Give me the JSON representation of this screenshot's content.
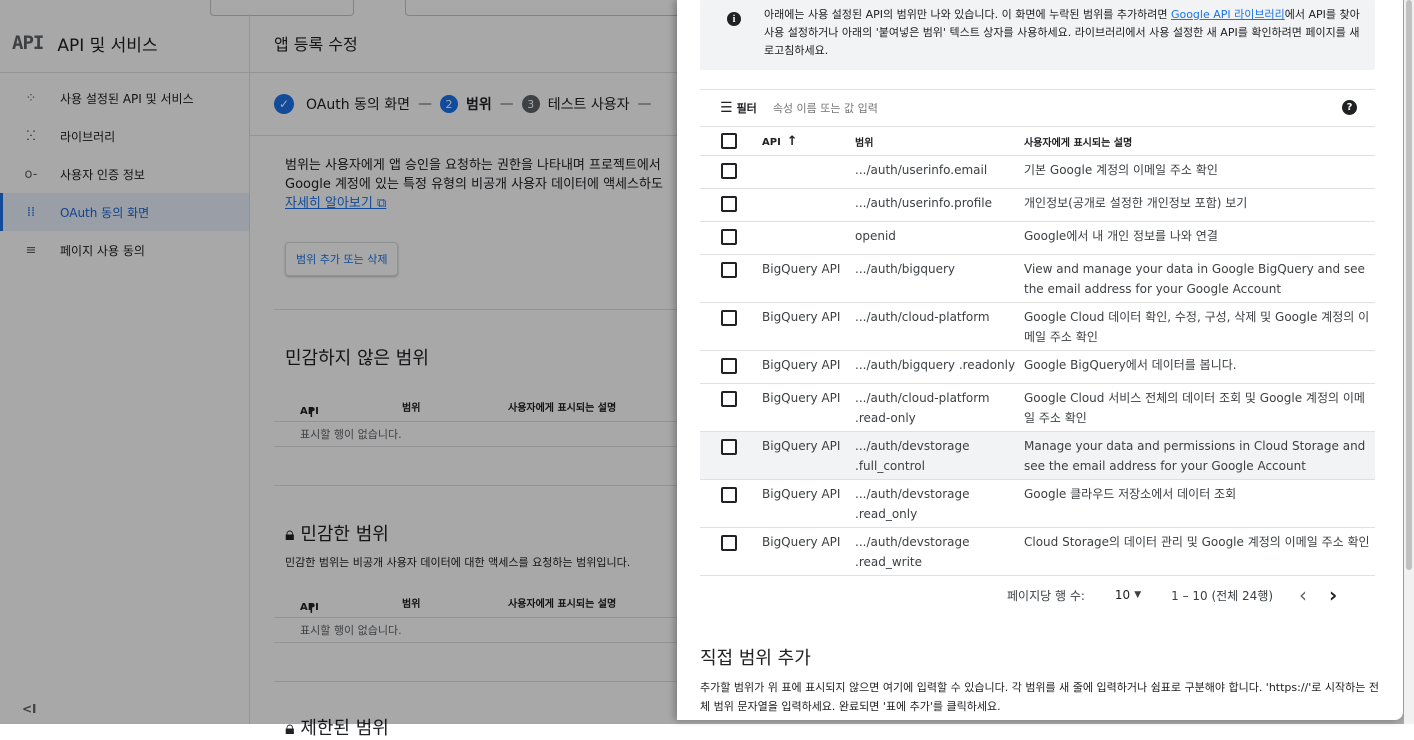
{
  "left_nav": {
    "logo": "API",
    "title": "API 및 서비스",
    "items": [
      {
        "label": "사용 설정된 API 및 서비스",
        "icon": "diamond-arrows-icon",
        "glyph": "⁘"
      },
      {
        "label": "라이브러리",
        "icon": "library-grid-icon",
        "glyph": "ⵘ"
      },
      {
        "label": "사용자 인증 정보",
        "icon": "key-icon",
        "glyph": "o-"
      },
      {
        "label": "OAuth 동의 화면",
        "icon": "oauth-dots-icon",
        "glyph": "⁞⁞"
      },
      {
        "label": "페이지 사용 동의",
        "icon": "list-settings-icon",
        "glyph": "≡"
      }
    ],
    "active_index": 3,
    "collapse_label": "<I"
  },
  "main": {
    "header": "앱 등록 수정",
    "steps": [
      {
        "marker": "✓",
        "label": "OAuth 동의 화면"
      },
      {
        "marker": "2",
        "label": "범위"
      },
      {
        "marker": "3",
        "label": "테스트 사용자"
      }
    ],
    "step_separator": "—",
    "description_line1": "범위는 사용자에게 앱 승인을 요청하는 권한을 나타내며 프로젝트에서",
    "description_line2": "Google 계정에 있는 특정 유형의 비공개 사용자 데이터에 액세스하도",
    "learn_more": "자세히 알아보기 ⧉",
    "add_remove_button": "범위 추가 또는 삭제",
    "nonsensitive": {
      "title": "민감하지 않은 범위",
      "col_api": "API",
      "col_scope": "범위",
      "col_desc": "사용자에게 표시되는 설명",
      "empty": "표시할 행이 없습니다."
    },
    "sensitive": {
      "title": "민감한 범위",
      "subtitle": "민감한 범위는 비공개 사용자 데이터에 대한 액세스를 요청하는 범위입니다.",
      "col_api": "API",
      "col_scope": "범위",
      "col_desc": "사용자에게 표시되는 설명",
      "empty": "표시할 행이 없습니다."
    },
    "restricted_title_partial": "제한된 범위"
  },
  "panel": {
    "info_text_before_link": "아래에는 사용 설정된 API의 범위만 나와 있습니다. 이 화면에 누락된 범위를 추가하려면 ",
    "info_link": "Google API 라이브러리",
    "info_text_after_link": "에서 API를 찾아 사용 설정하거나 아래의 '붙여넣은 범위' 텍스트 상자를 사용하세요. 라이브러리에서 사용 설정한 새 API를 확인하려면 페이지를 새로고침하세요.",
    "filter_label": "필터",
    "filter_placeholder": "속성 이름 또는 값 입력",
    "columns": {
      "api": "API",
      "scope": "범위",
      "desc": "사용자에게 표시되는 설명"
    },
    "rows": [
      {
        "api": "",
        "scope": ".../auth/userinfo.email",
        "desc": "기본 Google 계정의 이메일 주소 확인"
      },
      {
        "api": "",
        "scope": ".../auth/userinfo.profile",
        "desc": "개인정보(공개로 설정한 개인정보 포함) 보기"
      },
      {
        "api": "",
        "scope": "openid",
        "desc": "Google에서 내 개인 정보를 나와 연결"
      },
      {
        "api": "BigQuery API",
        "scope": ".../auth/bigquery",
        "desc": "View and manage your data in Google BigQuery and see the email address for your Google Account"
      },
      {
        "api": "BigQuery API",
        "scope": ".../auth/cloud-platform",
        "desc": "Google Cloud 데이터 확인, 수정, 구성, 삭제 및 Google 계정의 이메일 주소 확인"
      },
      {
        "api": "BigQuery API",
        "scope": ".../auth/bigquery .readonly",
        "desc": "Google BigQuery에서 데이터를 봅니다."
      },
      {
        "api": "BigQuery API",
        "scope": ".../auth/cloud-platform .read-only",
        "desc": "Google Cloud 서비스 전체의 데이터 조회 및 Google 계정의 이메일 주소 확인"
      },
      {
        "api": "BigQuery API",
        "scope": ".../auth/devstorage .full_control",
        "desc": "Manage your data and permissions in Cloud Storage and see the email address for your Google Account"
      },
      {
        "api": "BigQuery API",
        "scope": ".../auth/devstorage .read_only",
        "desc": "Google 클라우드 저장소에서 데이터 조회"
      },
      {
        "api": "BigQuery API",
        "scope": ".../auth/devstorage .read_write",
        "desc": "Cloud Storage의 데이터 관리 및 Google 계정의 이메일 주소 확인"
      }
    ],
    "highlighted_row_index": 7,
    "pagination": {
      "rows_per_page_label": "페이지당 행 수:",
      "rows_per_page_value": "10",
      "range": "1 – 10 (전체 24행)"
    },
    "manual_add": {
      "title": "직접 범위 추가",
      "description": "추가할 범위가 위 표에 표시되지 않으면 여기에 입력할 수 있습니다. 각 범위를 새 줄에 입력하거나 쉼표로 구분해야 합니다. 'https://'로 시작하는 전체 범위 문자열을 입력하세요. 완료되면 '표에 추가'를 클릭하세요."
    }
  }
}
